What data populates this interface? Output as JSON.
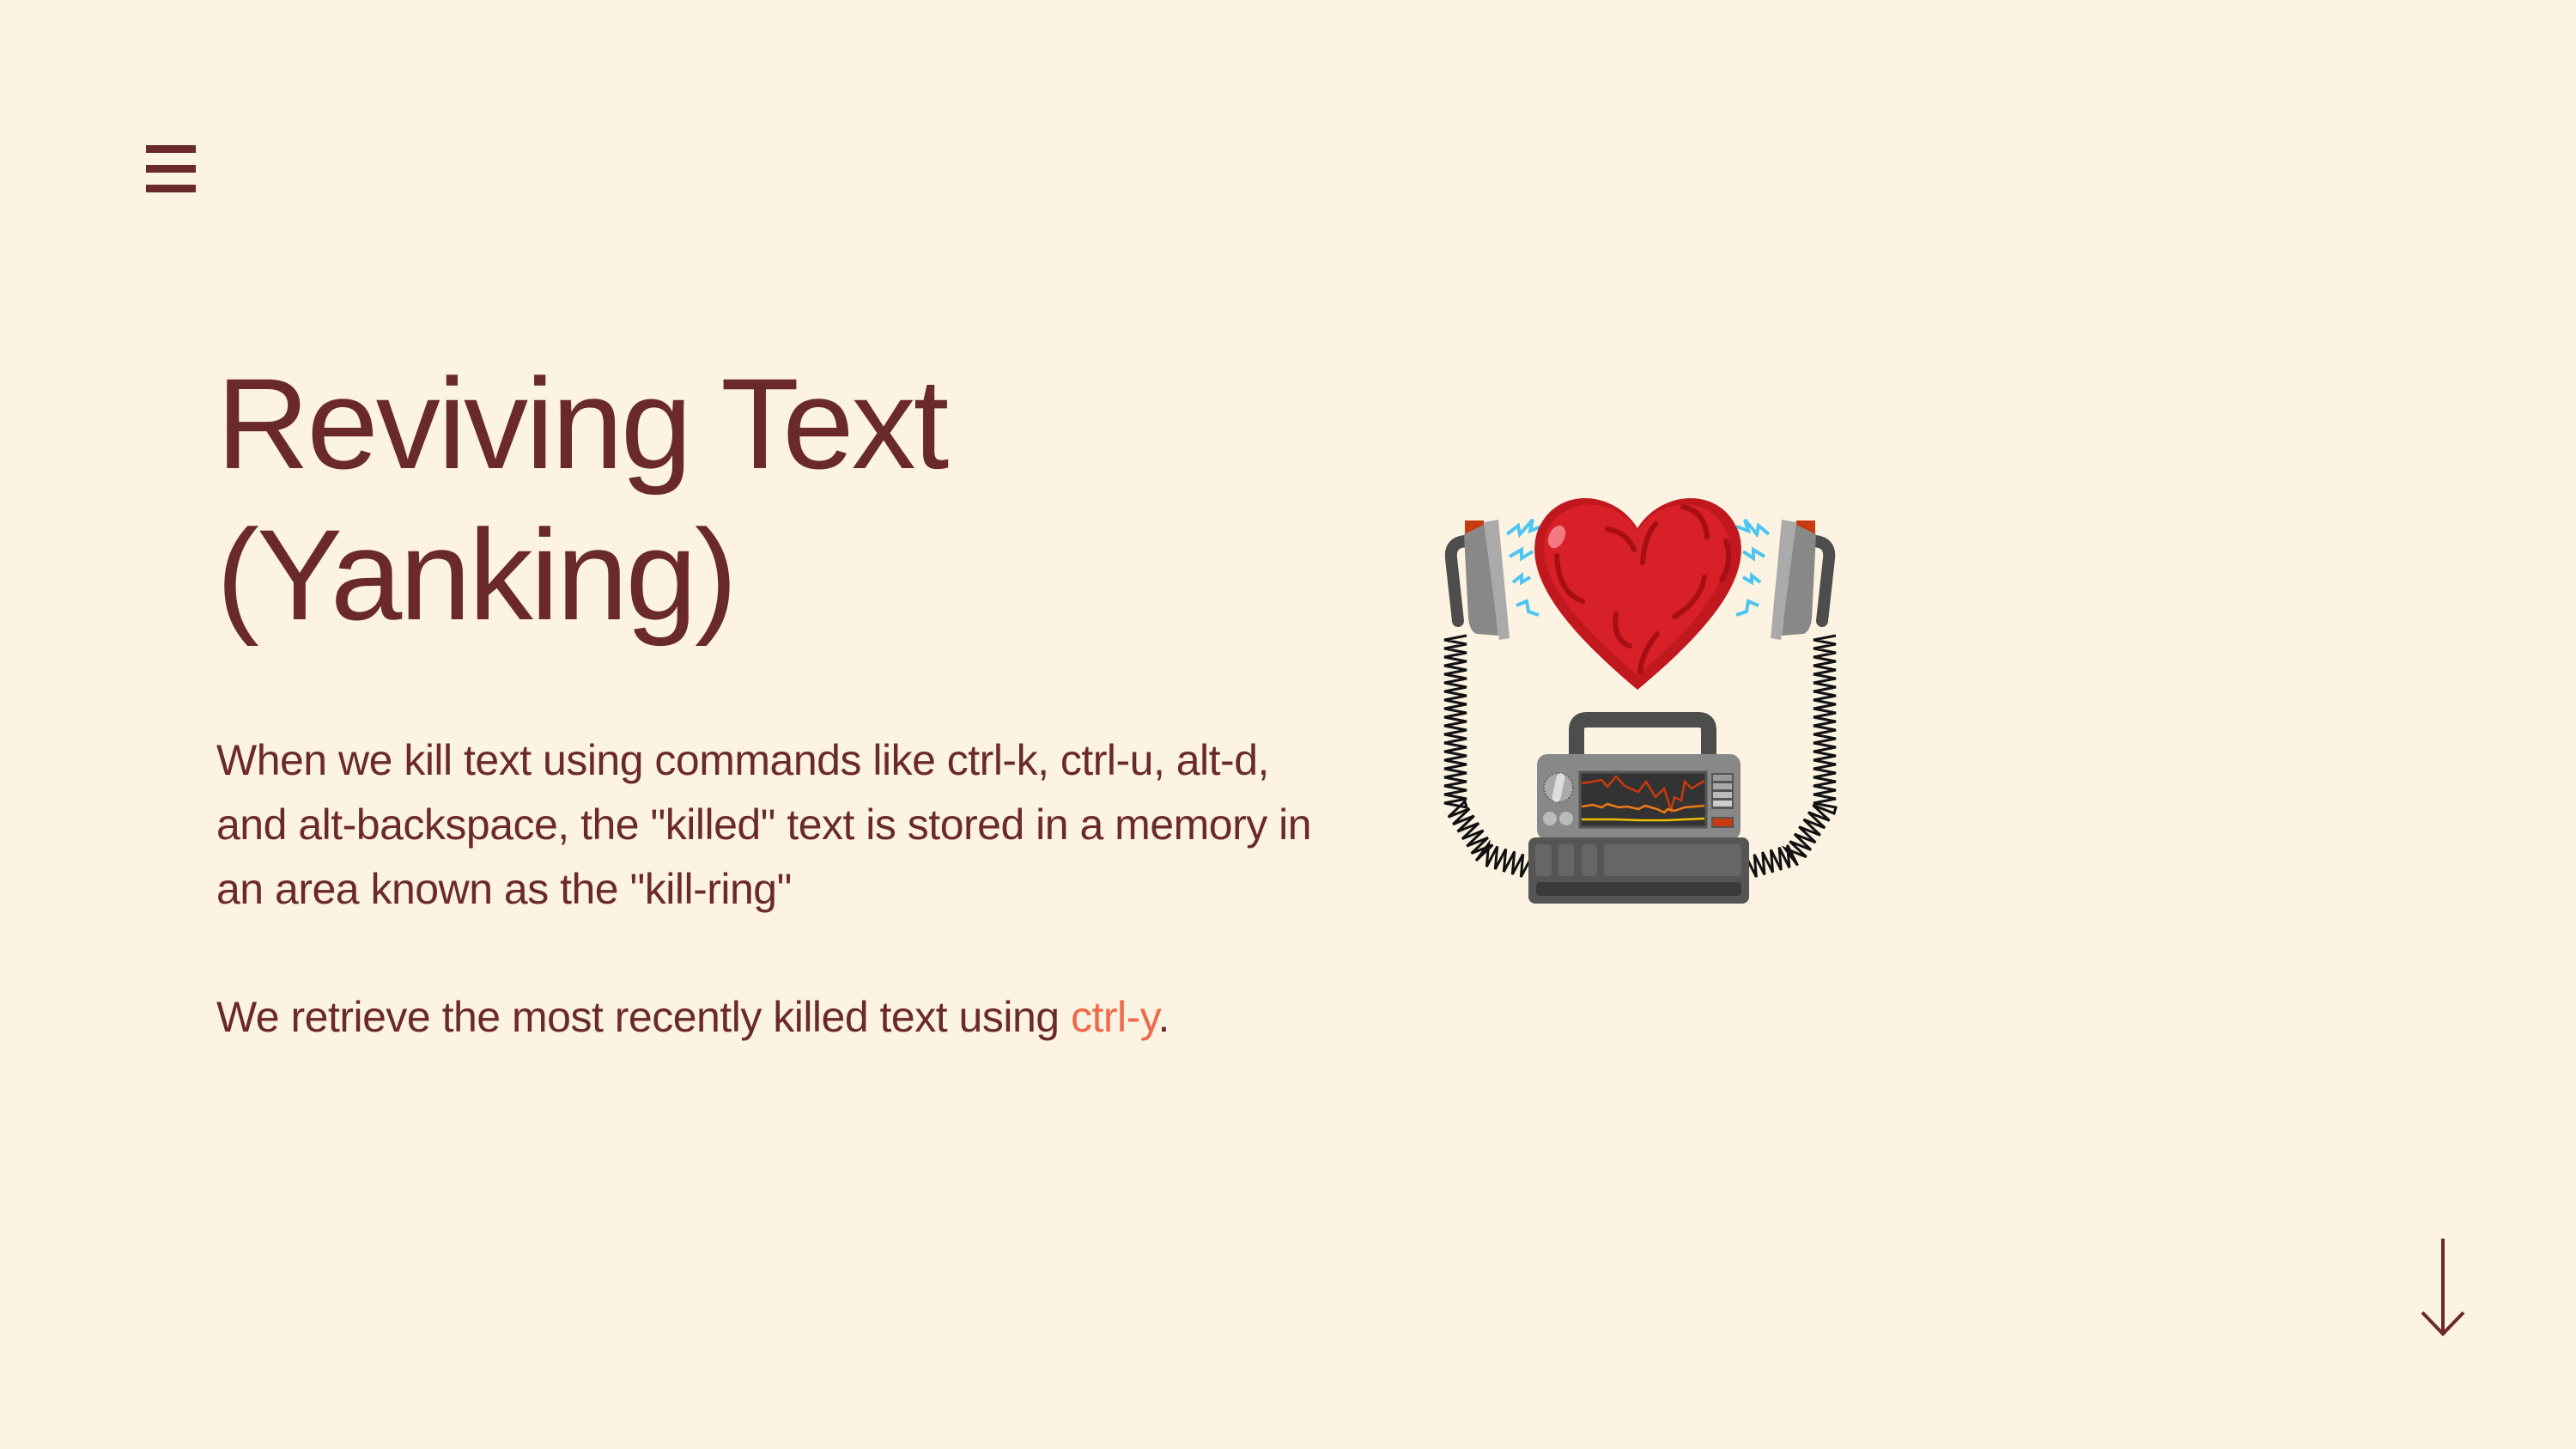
{
  "nav": {
    "menu_icon": "hamburger-icon",
    "scroll_icon": "arrow-down-icon"
  },
  "title": {
    "line1": "Reviving Text",
    "line2": "(Yanking)"
  },
  "body": {
    "paragraph1": "When we kill text using commands like ctrl-k, ctrl-u, alt-d, and alt-backspace, the \"killed\" text is stored in a memory in an area known as the \"kill-ring\"",
    "paragraph2_prefix": "We retrieve the most recently killed text using ",
    "paragraph2_highlight": "ctrl-y",
    "paragraph2_suffix": "."
  },
  "illustration": {
    "subject": "heart-with-defibrillator"
  },
  "colors": {
    "background": "#fdf3e3",
    "text": "#6b2a2a",
    "accent": "#f06a4a",
    "heart": "#d72027"
  }
}
